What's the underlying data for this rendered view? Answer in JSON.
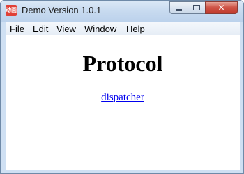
{
  "window": {
    "title": "Demo Version 1.0.1",
    "app_icon_text": "动画",
    "controls": {
      "minimize_icon": "minimize-icon",
      "maximize_icon": "maximize-icon",
      "close_icon": "close-icon",
      "close_glyph": "✕"
    }
  },
  "menubar": {
    "items": [
      "File",
      "Edit",
      "View",
      "Window",
      "Help"
    ]
  },
  "main": {
    "heading": "Protocol",
    "link": "dispatcher"
  },
  "colors": {
    "link": "#0000ee",
    "close_button": "#c0392b"
  }
}
